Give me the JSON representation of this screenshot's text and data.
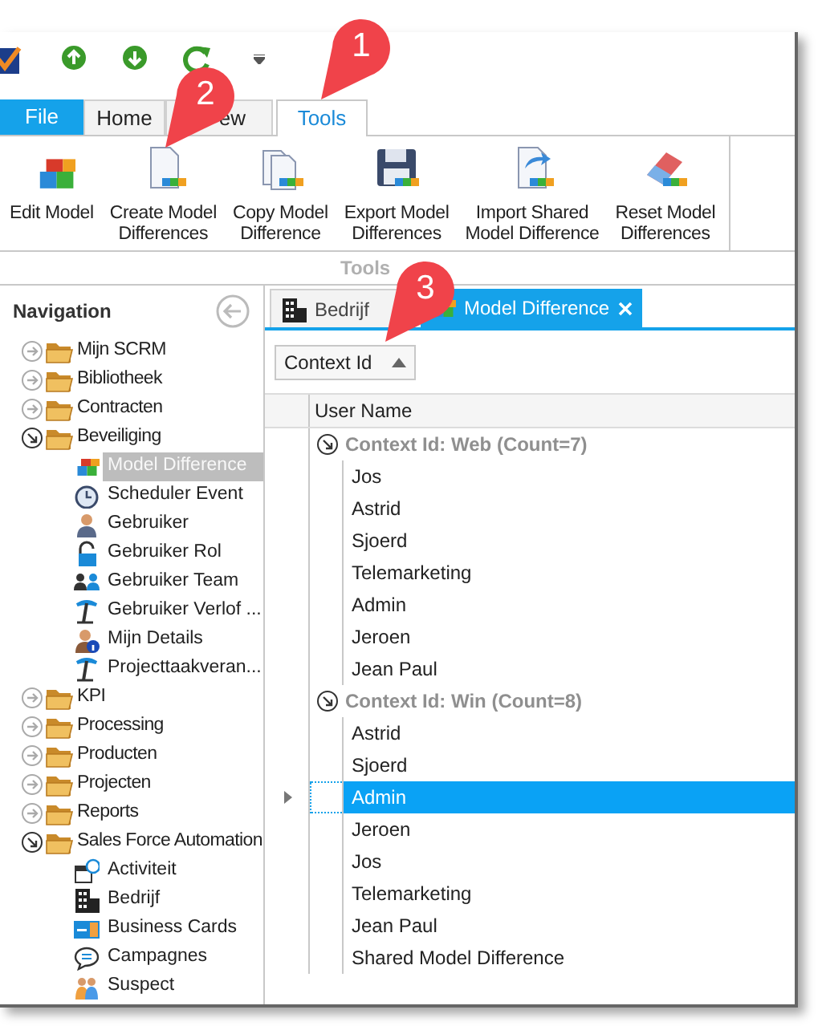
{
  "ribbon": {
    "tabs": [
      {
        "label": "File",
        "kind": "file",
        "selected": false
      },
      {
        "label": "Home",
        "kind": "tab",
        "selected": false
      },
      {
        "label": "ew",
        "kind": "tab",
        "selected": false
      },
      {
        "label": "Tools",
        "kind": "tab",
        "selected": true
      }
    ],
    "buttons": [
      {
        "label": "Edit Model",
        "kind": "cubes"
      },
      {
        "label": "Create Model\nDifferences",
        "kind": "doc"
      },
      {
        "label": "Copy Model\nDifference",
        "kind": "docs"
      },
      {
        "label": "Export Model\nDifferences",
        "kind": "floppy"
      },
      {
        "label": "Import Shared\nModel Difference",
        "kind": "import"
      },
      {
        "label": "Reset Model\nDifferences",
        "kind": "eraser"
      }
    ],
    "group_label": "Tools"
  },
  "navigation": {
    "title": "Navigation",
    "items": [
      {
        "label": "Mijn SCRM",
        "expanded": false
      },
      {
        "label": "Bibliotheek",
        "expanded": false
      },
      {
        "label": "Contracten",
        "expanded": false
      },
      {
        "label": "Beveiliging",
        "expanded": true,
        "children": [
          {
            "label": "Model Difference",
            "kind": "model",
            "selected": true
          },
          {
            "label": "Scheduler Event",
            "kind": "clock",
            "selected": false
          },
          {
            "label": "Gebruiker",
            "kind": "user",
            "selected": false
          },
          {
            "label": "Gebruiker Rol",
            "kind": "lock",
            "selected": false
          },
          {
            "label": "Gebruiker Team",
            "kind": "team",
            "selected": false
          },
          {
            "label": "Gebruiker Verlof ...",
            "kind": "palm",
            "selected": false
          },
          {
            "label": "Mijn Details",
            "kind": "userinfo",
            "selected": false
          },
          {
            "label": "Projecttaakveran...",
            "kind": "palm",
            "selected": false
          }
        ]
      },
      {
        "label": "KPI",
        "expanded": false
      },
      {
        "label": "Processing",
        "expanded": false
      },
      {
        "label": "Producten",
        "expanded": false
      },
      {
        "label": "Projecten",
        "expanded": false
      },
      {
        "label": "Reports",
        "expanded": false
      },
      {
        "label": "Sales Force Automation",
        "expanded": true,
        "children": [
          {
            "label": "Activiteit",
            "kind": "calendar",
            "selected": false
          },
          {
            "label": "Bedrijf",
            "kind": "building",
            "selected": false
          },
          {
            "label": "Business Cards",
            "kind": "cards",
            "selected": false
          },
          {
            "label": "Campagnes",
            "kind": "speech",
            "selected": false
          },
          {
            "label": "Suspect",
            "kind": "people",
            "selected": false
          }
        ]
      }
    ]
  },
  "document_tabs": [
    {
      "label": "Bedrijf",
      "kind": "building",
      "selected": false
    },
    {
      "label": "Model Difference",
      "kind": "model",
      "selected": true
    }
  ],
  "group_panel": {
    "label": "Context Id"
  },
  "grid": {
    "column": "User Name",
    "groups": [
      {
        "title": "Context Id: Web (Count=7)",
        "expanded": true,
        "rows": [
          {
            "user_name": "Jos",
            "selected": false
          },
          {
            "user_name": "Astrid",
            "selected": false
          },
          {
            "user_name": "Sjoerd",
            "selected": false
          },
          {
            "user_name": "Telemarketing",
            "selected": false
          },
          {
            "user_name": "Admin",
            "selected": false
          },
          {
            "user_name": "Jeroen",
            "selected": false
          },
          {
            "user_name": "Jean Paul",
            "selected": false
          }
        ]
      },
      {
        "title": "Context Id: Win (Count=8)",
        "expanded": true,
        "rows": [
          {
            "user_name": "Astrid",
            "selected": false
          },
          {
            "user_name": "Sjoerd",
            "selected": false
          },
          {
            "user_name": "Admin",
            "selected": true
          },
          {
            "user_name": "Jeroen",
            "selected": false
          },
          {
            "user_name": "Jos",
            "selected": false
          },
          {
            "user_name": "Telemarketing",
            "selected": false
          },
          {
            "user_name": "Jean Paul",
            "selected": false
          },
          {
            "user_name": "Shared Model Difference",
            "selected": false
          }
        ]
      }
    ]
  },
  "callouts": [
    {
      "number": "1"
    },
    {
      "number": "2"
    },
    {
      "number": "3"
    }
  ]
}
